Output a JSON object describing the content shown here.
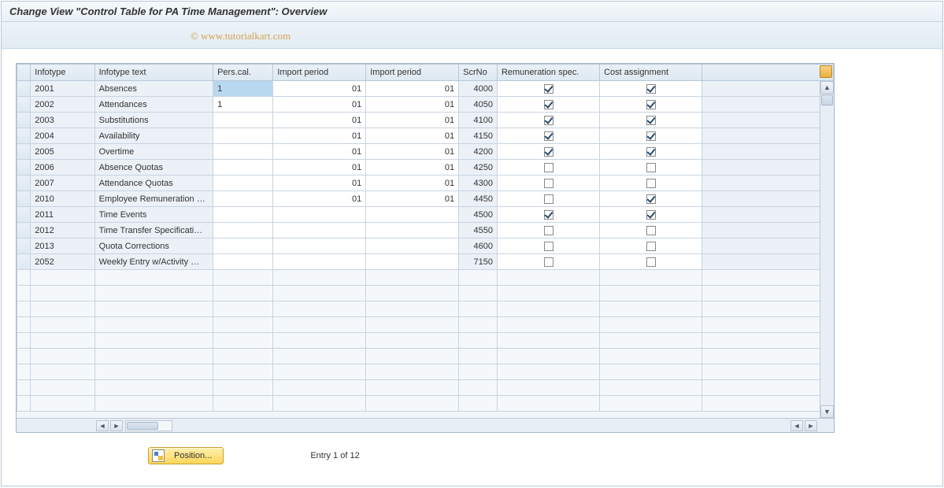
{
  "title": "Change View \"Control Table for PA Time Management\": Overview",
  "watermark": "© www.tutorialkart.com",
  "columns": {
    "selector": "",
    "infotype": "Infotype",
    "infotype_text": "Infotype text",
    "pers_cal": "Pers.cal.",
    "import_period1": "Import period",
    "import_period2": "Import period",
    "scr_no": "ScrNo",
    "remun": "Remuneration spec.",
    "cost": "Cost assignment"
  },
  "rows": [
    {
      "infotype": "2001",
      "text": "Absences",
      "pers": "1",
      "p1": "01",
      "p2": "01",
      "scr": "4000",
      "remun": true,
      "cost": true,
      "pers_sel": true
    },
    {
      "infotype": "2002",
      "text": "Attendances",
      "pers": "1",
      "p1": "01",
      "p2": "01",
      "scr": "4050",
      "remun": true,
      "cost": true
    },
    {
      "infotype": "2003",
      "text": "Substitutions",
      "pers": "",
      "p1": "01",
      "p2": "01",
      "scr": "4100",
      "remun": true,
      "cost": true
    },
    {
      "infotype": "2004",
      "text": "Availability",
      "pers": "",
      "p1": "01",
      "p2": "01",
      "scr": "4150",
      "remun": true,
      "cost": true
    },
    {
      "infotype": "2005",
      "text": "Overtime",
      "pers": "",
      "p1": "01",
      "p2": "01",
      "scr": "4200",
      "remun": true,
      "cost": true
    },
    {
      "infotype": "2006",
      "text": "Absence Quotas",
      "pers": "",
      "p1": "01",
      "p2": "01",
      "scr": "4250",
      "remun": false,
      "cost": false
    },
    {
      "infotype": "2007",
      "text": "Attendance Quotas",
      "pers": "",
      "p1": "01",
      "p2": "01",
      "scr": "4300",
      "remun": false,
      "cost": false
    },
    {
      "infotype": "2010",
      "text": "Employee Remuneration …",
      "pers": "",
      "p1": "01",
      "p2": "01",
      "scr": "4450",
      "remun": false,
      "cost": true
    },
    {
      "infotype": "2011",
      "text": "Time Events",
      "pers": "",
      "p1": "",
      "p2": "",
      "scr": "4500",
      "remun": true,
      "cost": true
    },
    {
      "infotype": "2012",
      "text": "Time Transfer Specificati…",
      "pers": "",
      "p1": "",
      "p2": "",
      "scr": "4550",
      "remun": false,
      "cost": false
    },
    {
      "infotype": "2013",
      "text": "Quota Corrections",
      "pers": "",
      "p1": "",
      "p2": "",
      "scr": "4600",
      "remun": false,
      "cost": false
    },
    {
      "infotype": "2052",
      "text": "Weekly Entry w/Activity …",
      "pers": "",
      "p1": "",
      "p2": "",
      "scr": "7150",
      "remun": false,
      "cost": false
    }
  ],
  "empty_rows": 9,
  "footer": {
    "position_label": "Position...",
    "entry_status": "Entry 1 of 12"
  }
}
